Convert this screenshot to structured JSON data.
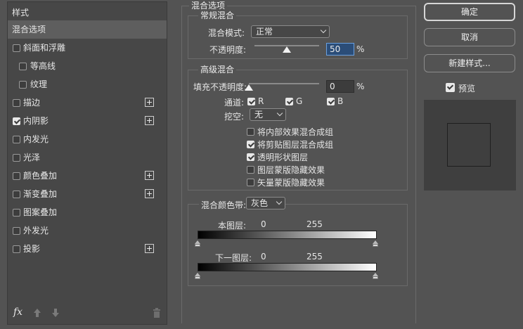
{
  "styles_panel": {
    "header": "样式",
    "items": [
      {
        "label": "混合选项",
        "selected": true,
        "checkbox": false
      },
      {
        "label": "斜面和浮雕",
        "checkbox": true,
        "checked": false
      },
      {
        "label": "等高线",
        "checkbox": true,
        "checked": false,
        "indent": true
      },
      {
        "label": "纹理",
        "checkbox": true,
        "checked": false,
        "indent": true
      },
      {
        "label": "描边",
        "checkbox": true,
        "checked": false,
        "plus": true
      },
      {
        "label": "内阴影",
        "checkbox": true,
        "checked": true,
        "plus": true
      },
      {
        "label": "内发光",
        "checkbox": true,
        "checked": false
      },
      {
        "label": "光泽",
        "checkbox": true,
        "checked": false
      },
      {
        "label": "颜色叠加",
        "checkbox": true,
        "checked": false,
        "plus": true
      },
      {
        "label": "渐变叠加",
        "checkbox": true,
        "checked": false,
        "plus": true
      },
      {
        "label": "图案叠加",
        "checkbox": true,
        "checked": false
      },
      {
        "label": "外发光",
        "checkbox": true,
        "checked": false
      },
      {
        "label": "投影",
        "checkbox": true,
        "checked": false,
        "plus": true
      }
    ],
    "footer": {
      "fx_label": "fx"
    }
  },
  "blend_options": {
    "section_title": "混合选项",
    "general": {
      "title": "常规混合",
      "mode_label": "混合模式:",
      "mode_value": "正常",
      "opacity_label": "不透明度:",
      "opacity_value": "50",
      "opacity_percent": 0.5,
      "unit": "%"
    },
    "advanced": {
      "title": "高级混合",
      "fill_label": "填充不透明度:",
      "fill_value": "0",
      "fill_percent": 0,
      "unit": "%",
      "channels_label": "通道:",
      "channels": [
        {
          "label": "R",
          "checked": true
        },
        {
          "label": "G",
          "checked": true
        },
        {
          "label": "B",
          "checked": true
        }
      ],
      "knockout_label": "挖空:",
      "knockout_value": "无",
      "options": [
        {
          "label": "将内部效果混合成组",
          "checked": false
        },
        {
          "label": "将剪贴图层混合成组",
          "checked": true
        },
        {
          "label": "透明形状图层",
          "checked": true
        },
        {
          "label": "图层蒙版隐藏效果",
          "checked": false
        },
        {
          "label": "矢量蒙版隐藏效果",
          "checked": false
        }
      ]
    },
    "blend_if": {
      "label": "混合颜色带:",
      "value": "灰色",
      "this_layer": {
        "label": "本图层:",
        "min": "0",
        "max": "255"
      },
      "underlying_layer": {
        "label": "下一图层:",
        "min": "0",
        "max": "255"
      }
    }
  },
  "buttons": {
    "ok": "确定",
    "cancel": "取消",
    "new_style": "新建样式..."
  },
  "preview": {
    "label": "预览",
    "checked": true
  }
}
